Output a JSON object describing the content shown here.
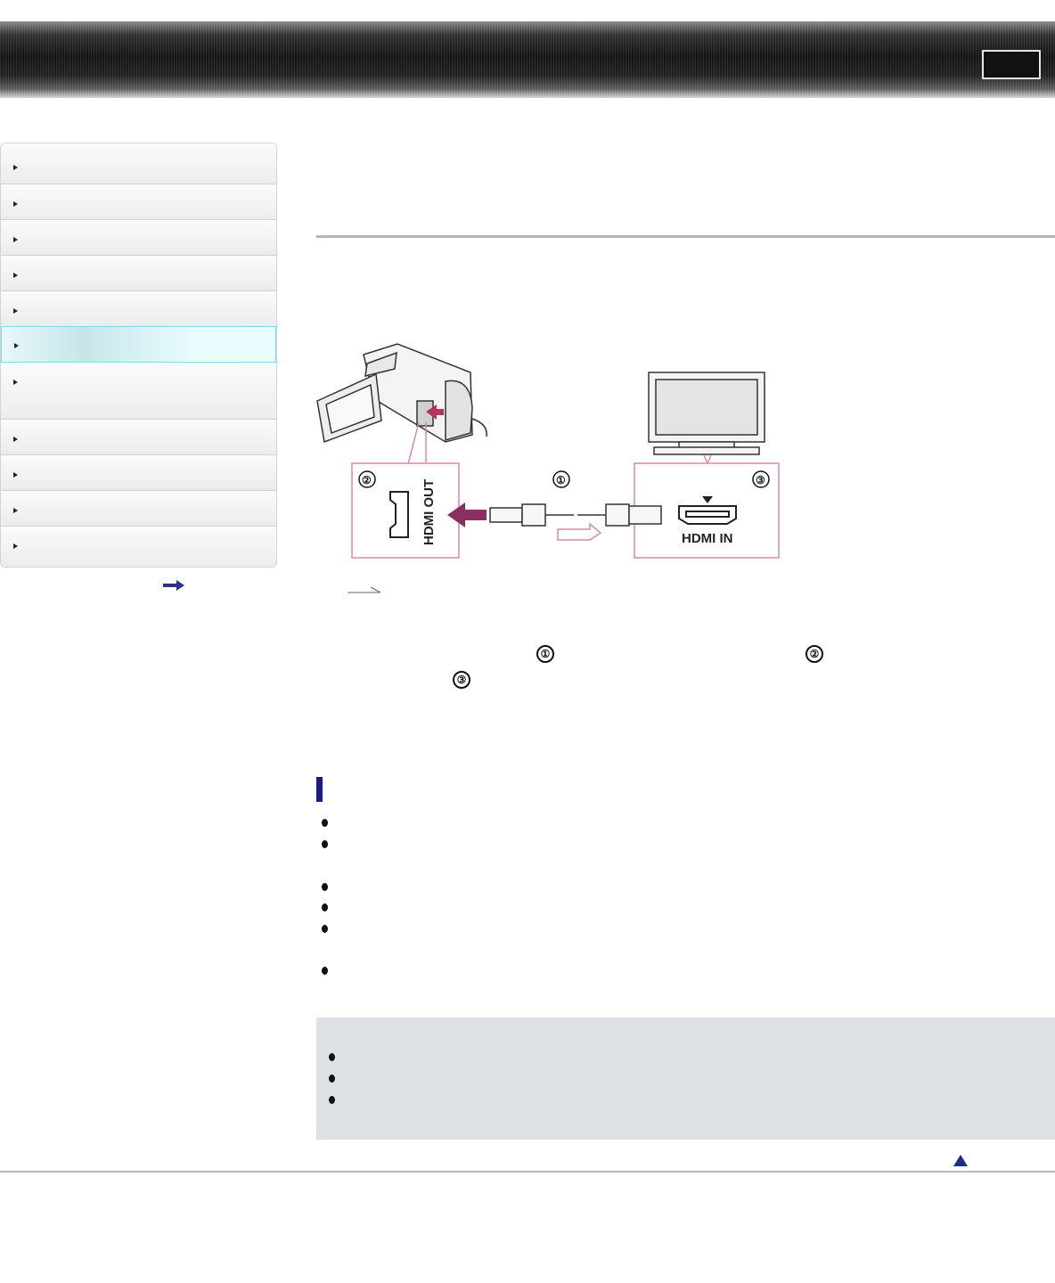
{
  "header": {
    "button_label": ""
  },
  "sidebar": {
    "items": [
      {
        "label": "",
        "active": false
      },
      {
        "label": "",
        "active": false
      },
      {
        "label": "",
        "active": false
      },
      {
        "label": "",
        "active": false
      },
      {
        "label": "",
        "active": false
      },
      {
        "label": "",
        "active": true
      },
      {
        "label": "",
        "active": false
      },
      {
        "label": "",
        "active": false
      },
      {
        "label": "",
        "active": false
      },
      {
        "label": "",
        "active": false
      },
      {
        "label": "",
        "active": false
      }
    ]
  },
  "diagram": {
    "camera_port_label": "HDMI OUT",
    "tv_port_label": "HDMI IN",
    "markers": [
      "①",
      "②",
      "③"
    ]
  },
  "instructions": {
    "markers": [
      "①",
      "②",
      "③"
    ]
  },
  "notes": {
    "bullet_count": 6
  },
  "tips": {
    "bullet_count": 3
  },
  "colors": {
    "active_nav_border": "#7fd9ec",
    "note_marker": "#1b1b8a",
    "diagram_line": "#d98aa3",
    "plug_arrow": "#8b2f63",
    "page_top_icon": "#1b2f8a"
  },
  "icons": {
    "more_link": "right-arrow-icon",
    "page_top": "up-triangle-icon",
    "signal_direction": "outline-arrow-icon"
  }
}
